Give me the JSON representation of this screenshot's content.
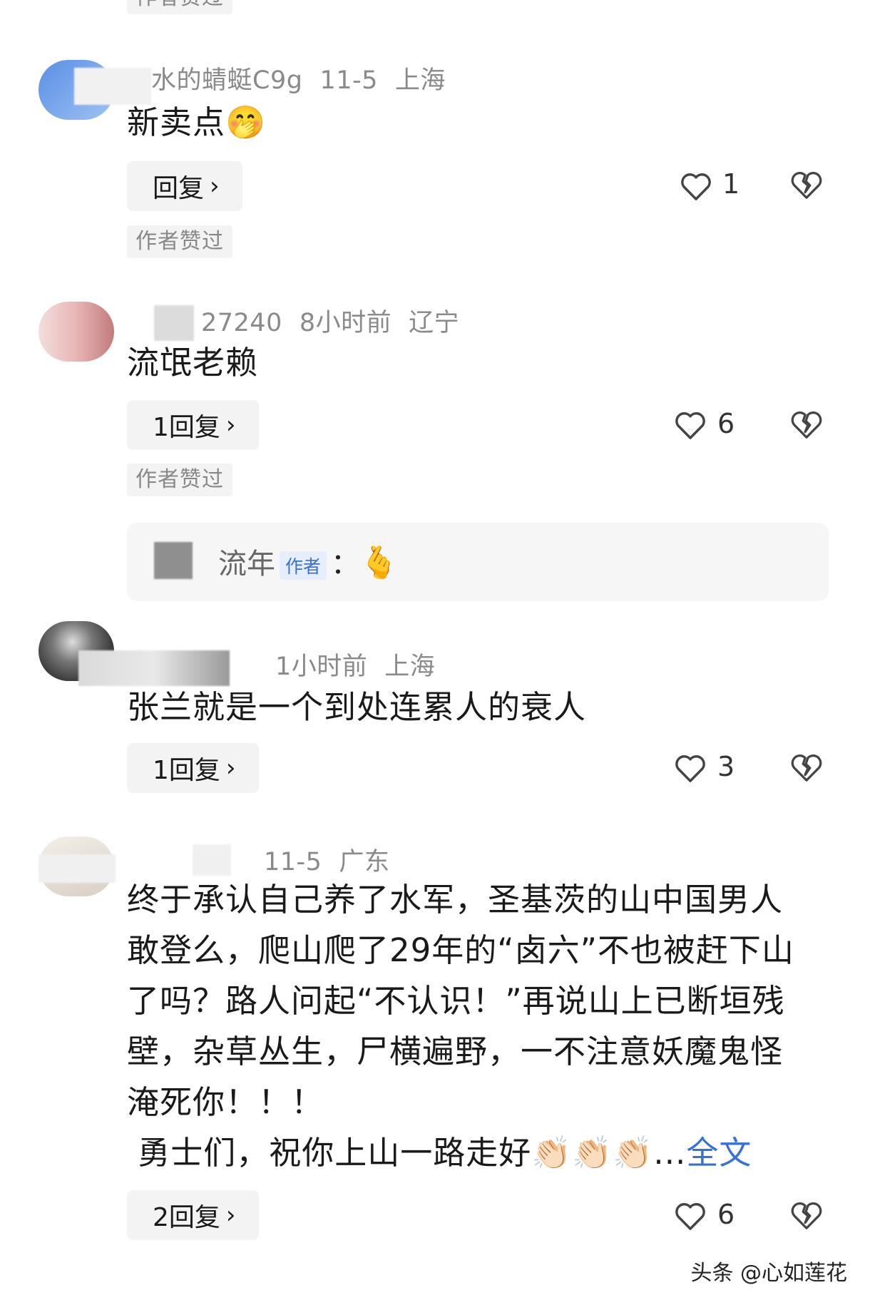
{
  "top_tag": "作者赞过",
  "comments": [
    {
      "user": "水的蜻蜓C9g",
      "date": "11-5",
      "location": "上海",
      "text": "新卖点",
      "emoji": "🤭",
      "reply_label": "回复",
      "likes": "1",
      "author_liked": "作者赞过"
    },
    {
      "user": "27240",
      "date": "8小时前",
      "location": "辽宁",
      "text": "流氓老赖",
      "reply_label": "1回复",
      "likes": "6",
      "author_liked": "作者赞过",
      "author_reply": {
        "name": "流年",
        "badge": "作者",
        "colon": "：",
        "emoji": "🫰"
      }
    },
    {
      "user": "",
      "date": "1小时前",
      "location": "上海",
      "text": "张兰就是一个到处连累人的衰人",
      "reply_label": "1回复",
      "likes": "3"
    },
    {
      "user": "",
      "date": "11-5",
      "location": "广东",
      "lines": [
        "终于承认自己养了水军，圣基茨的山中国男人",
        "敢登么，爬山爬了29年的“卤六”不也被赶下山",
        "了吗？路人问起“不认识！”再说山上已断垣残",
        "壁，杂草丛生，尸横遍野，一不注意妖魔鬼怪",
        "淹死你！！！"
      ],
      "last_line": " 勇士们，祝你上山一路走好",
      "last_emojis": "👏🏻👏🏻👏🏻",
      "ellipsis": "...",
      "full_text_link": "全文",
      "reply_label": "2回复",
      "likes": "6"
    }
  ],
  "reply_chevron": "›",
  "watermark": "头条 @心如莲花",
  "colors": {
    "accent_link": "#3771d6",
    "meta_gray": "#8a8a8a",
    "button_bg": "#f3f3f3"
  }
}
